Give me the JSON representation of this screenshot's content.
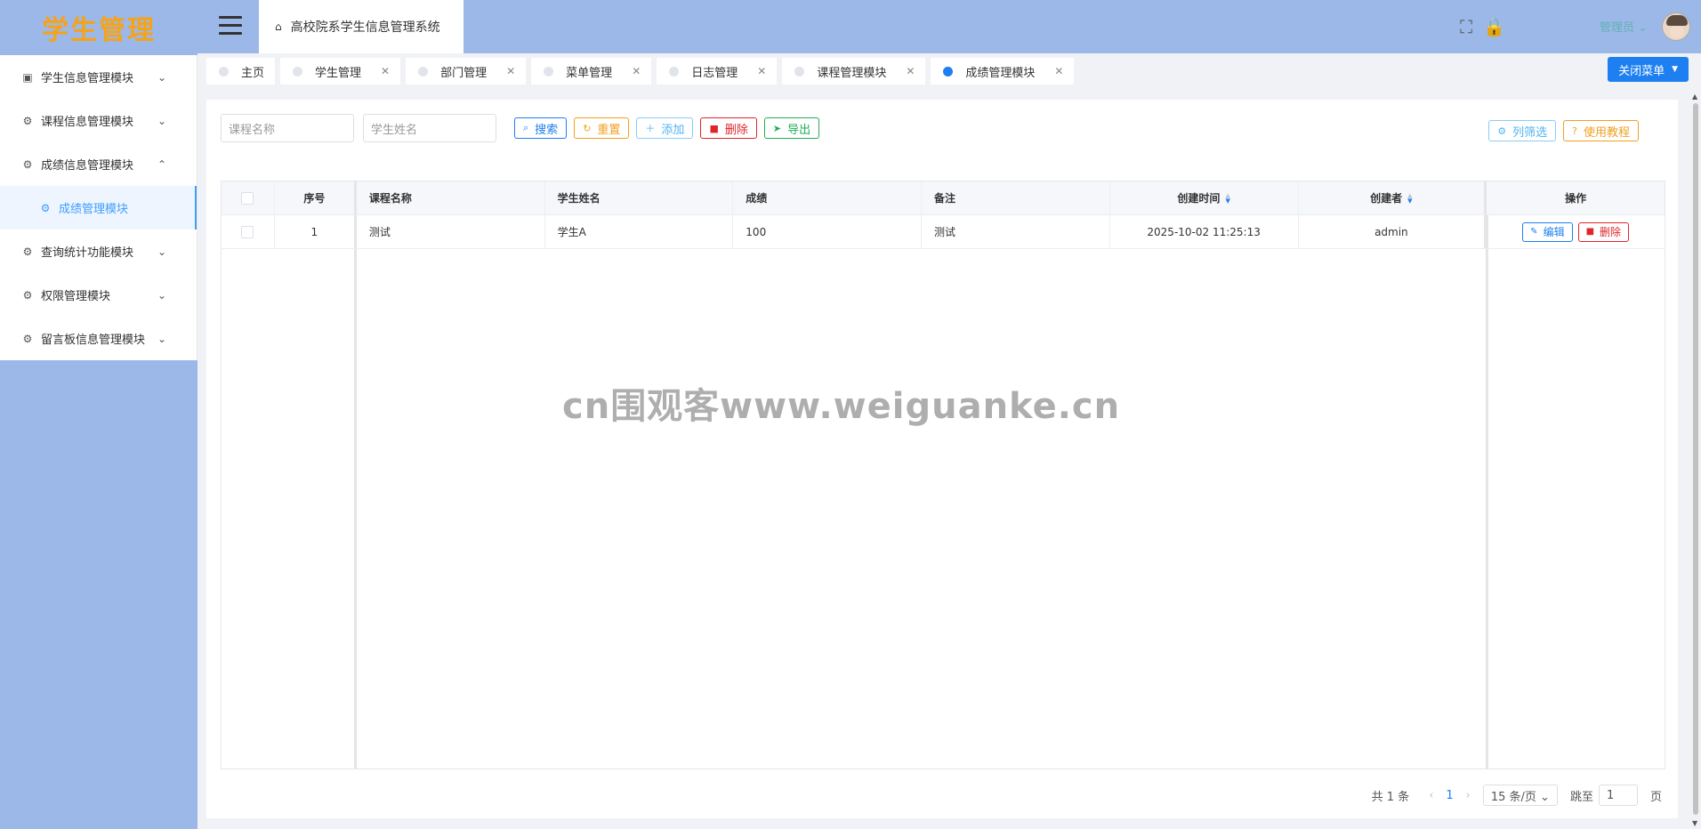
{
  "logo": {
    "text": "学生管理"
  },
  "sidebar": {
    "items": [
      {
        "label": "学生信息管理模块",
        "icon": "chart-icon",
        "glyph": "▣",
        "chevron": "⌄"
      },
      {
        "label": "课程信息管理模块",
        "icon": "settings-icon",
        "glyph": "⚙",
        "chevron": "⌄"
      },
      {
        "label": "成绩信息管理模块",
        "icon": "settings-icon",
        "glyph": "⚙",
        "chevron": "⌃"
      },
      {
        "label": "成绩管理模块",
        "icon": "settings-icon",
        "glyph": "⚙",
        "sub": true
      },
      {
        "label": "查询统计功能模块",
        "icon": "settings-icon",
        "glyph": "⚙",
        "chevron": "⌄"
      },
      {
        "label": "权限管理模块",
        "icon": "settings-icon",
        "glyph": "⚙",
        "chevron": "⌄"
      },
      {
        "label": "留言板信息管理模块",
        "icon": "settings-icon",
        "glyph": "⚙",
        "chevron": "⌄"
      }
    ]
  },
  "header": {
    "breadcrumb": "高校院系学生信息管理系统",
    "home_glyph": "⌂",
    "fullscreen_glyph": "⛶",
    "lock_glyph": "🔒",
    "username": "管理员 ⌄"
  },
  "tabs": [
    {
      "label": "主页",
      "closable": false
    },
    {
      "label": "学生管理",
      "closable": true
    },
    {
      "label": "部门管理",
      "closable": true
    },
    {
      "label": "菜单管理",
      "closable": true
    },
    {
      "label": "日志管理",
      "closable": true
    },
    {
      "label": "课程管理模块",
      "closable": true
    },
    {
      "label": "成绩管理模块",
      "closable": true,
      "active": true
    }
  ],
  "close_menu": {
    "label": "关闭菜单",
    "caret": "▼"
  },
  "search": {
    "course_placeholder": "课程名称",
    "student_placeholder": "学生姓名",
    "search_label": "搜索",
    "reset_label": "重置",
    "add_label": "添加",
    "delete_label": "删除",
    "export_label": "导出",
    "column_filter_label": "列筛选",
    "tutorial_label": "使用教程"
  },
  "table": {
    "headers": {
      "index": "序号",
      "course": "课程名称",
      "student": "学生姓名",
      "score": "成绩",
      "remark": "备注",
      "created_time": "创建时间",
      "creator": "创建者",
      "ops": "操作"
    },
    "rows": [
      {
        "index": "1",
        "course": "测试",
        "student": "学生A",
        "score": "100",
        "remark": "测试",
        "created_time": "2025-10-02 11:25:13",
        "creator": "admin"
      }
    ],
    "edit_label": "编辑",
    "delete_label": "删除"
  },
  "pager": {
    "total": "共 1 条",
    "prev": "‹",
    "page": "1",
    "next": "›",
    "size": "15 条/页 ⌄",
    "jump_label": "跳至",
    "jump_value": "1",
    "page_unit": "页"
  },
  "watermark": "cn围观客www.weiguanke.cn",
  "colors": {
    "primary": "#1d7ff0",
    "header_bg": "#9cb8e8",
    "logo": "#f5a31a"
  }
}
